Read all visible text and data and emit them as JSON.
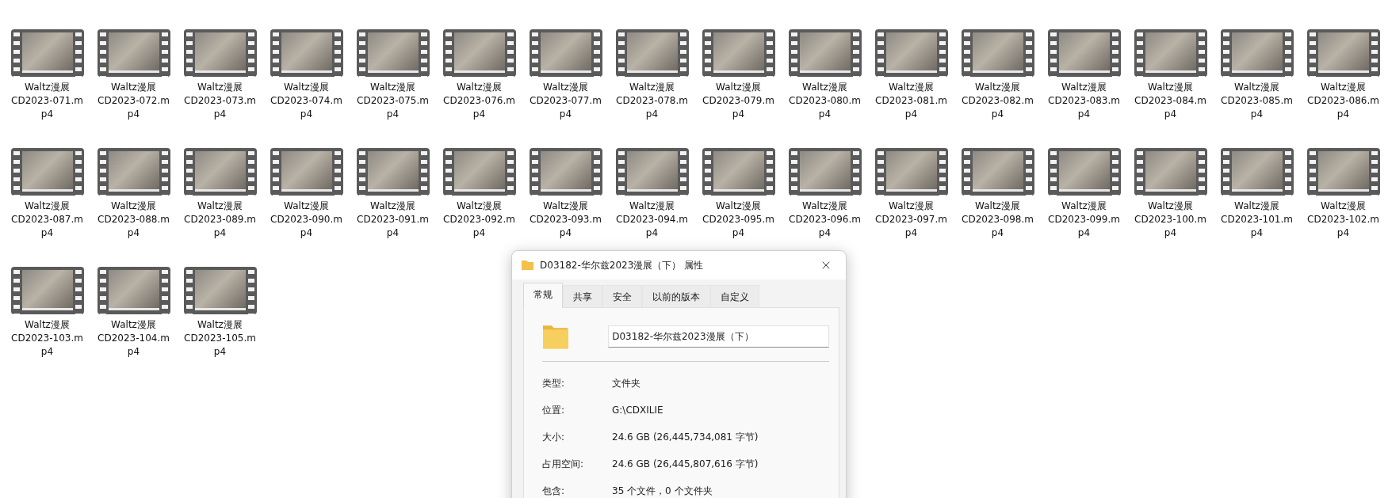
{
  "files": [
    {
      "name_lines": [
        "Waltz漫展",
        "CD2023-071.m",
        "p4"
      ]
    },
    {
      "name_lines": [
        "Waltz漫展",
        "CD2023-072.m",
        "p4"
      ]
    },
    {
      "name_lines": [
        "Waltz漫展",
        "CD2023-073.m",
        "p4"
      ]
    },
    {
      "name_lines": [
        "Waltz漫展",
        "CD2023-074.m",
        "p4"
      ]
    },
    {
      "name_lines": [
        "Waltz漫展",
        "CD2023-075.m",
        "p4"
      ]
    },
    {
      "name_lines": [
        "Waltz漫展",
        "CD2023-076.m",
        "p4"
      ]
    },
    {
      "name_lines": [
        "Waltz漫展",
        "CD2023-077.m",
        "p4"
      ]
    },
    {
      "name_lines": [
        "Waltz漫展",
        "CD2023-078.m",
        "p4"
      ]
    },
    {
      "name_lines": [
        "Waltz漫展",
        "CD2023-079.m",
        "p4"
      ]
    },
    {
      "name_lines": [
        "Waltz漫展",
        "CD2023-080.m",
        "p4"
      ]
    },
    {
      "name_lines": [
        "Waltz漫展",
        "CD2023-081.m",
        "p4"
      ]
    },
    {
      "name_lines": [
        "Waltz漫展",
        "CD2023-082.m",
        "p4"
      ]
    },
    {
      "name_lines": [
        "Waltz漫展",
        "CD2023-083.m",
        "p4"
      ]
    },
    {
      "name_lines": [
        "Waltz漫展",
        "CD2023-084.m",
        "p4"
      ]
    },
    {
      "name_lines": [
        "Waltz漫展",
        "CD2023-085.m",
        "p4"
      ]
    },
    {
      "name_lines": [
        "Waltz漫展",
        "CD2023-086.m",
        "p4"
      ]
    },
    {
      "name_lines": [
        "Waltz漫展",
        "CD2023-087.m",
        "p4"
      ]
    },
    {
      "name_lines": [
        "Waltz漫展",
        "CD2023-088.m",
        "p4"
      ]
    },
    {
      "name_lines": [
        "Waltz漫展",
        "CD2023-089.m",
        "p4"
      ]
    },
    {
      "name_lines": [
        "Waltz漫展",
        "CD2023-090.m",
        "p4"
      ]
    },
    {
      "name_lines": [
        "Waltz漫展",
        "CD2023-091.m",
        "p4"
      ]
    },
    {
      "name_lines": [
        "Waltz漫展",
        "CD2023-092.m",
        "p4"
      ]
    },
    {
      "name_lines": [
        "Waltz漫展",
        "CD2023-093.m",
        "p4"
      ]
    },
    {
      "name_lines": [
        "Waltz漫展",
        "CD2023-094.m",
        "p4"
      ]
    },
    {
      "name_lines": [
        "Waltz漫展",
        "CD2023-095.m",
        "p4"
      ]
    },
    {
      "name_lines": [
        "Waltz漫展",
        "CD2023-096.m",
        "p4"
      ]
    },
    {
      "name_lines": [
        "Waltz漫展",
        "CD2023-097.m",
        "p4"
      ]
    },
    {
      "name_lines": [
        "Waltz漫展",
        "CD2023-098.m",
        "p4"
      ]
    },
    {
      "name_lines": [
        "Waltz漫展",
        "CD2023-099.m",
        "p4"
      ]
    },
    {
      "name_lines": [
        "Waltz漫展",
        "CD2023-100.m",
        "p4"
      ]
    },
    {
      "name_lines": [
        "Waltz漫展",
        "CD2023-101.m",
        "p4"
      ]
    },
    {
      "name_lines": [
        "Waltz漫展",
        "CD2023-102.m",
        "p4"
      ]
    },
    {
      "name_lines": [
        "Waltz漫展",
        "CD2023-103.m",
        "p4"
      ]
    },
    {
      "name_lines": [
        "Waltz漫展",
        "CD2023-104.m",
        "p4"
      ]
    },
    {
      "name_lines": [
        "Waltz漫展",
        "CD2023-105.m",
        "p4"
      ]
    }
  ],
  "dialog": {
    "title": "D03182-华尔兹2023漫展（下） 属性",
    "tabs": [
      {
        "label": "常规",
        "selected": true
      },
      {
        "label": "共享",
        "selected": false
      },
      {
        "label": "安全",
        "selected": false
      },
      {
        "label": "以前的版本",
        "selected": false
      },
      {
        "label": "自定义",
        "selected": false
      }
    ],
    "name_field": {
      "value": "D03182-华尔兹2023漫展（下）"
    },
    "properties": [
      {
        "label": "类型:",
        "value": "文件夹"
      },
      {
        "label": "位置:",
        "value": "G:\\CDXILIE"
      },
      {
        "label": "大小:",
        "value": "24.6 GB (26,445,734,081 字节)"
      },
      {
        "label": "占用空间:",
        "value": "24.6 GB (26,445,807,616 字节)"
      },
      {
        "label": "包含:",
        "value": "35 个文件，0 个文件夹"
      }
    ]
  }
}
